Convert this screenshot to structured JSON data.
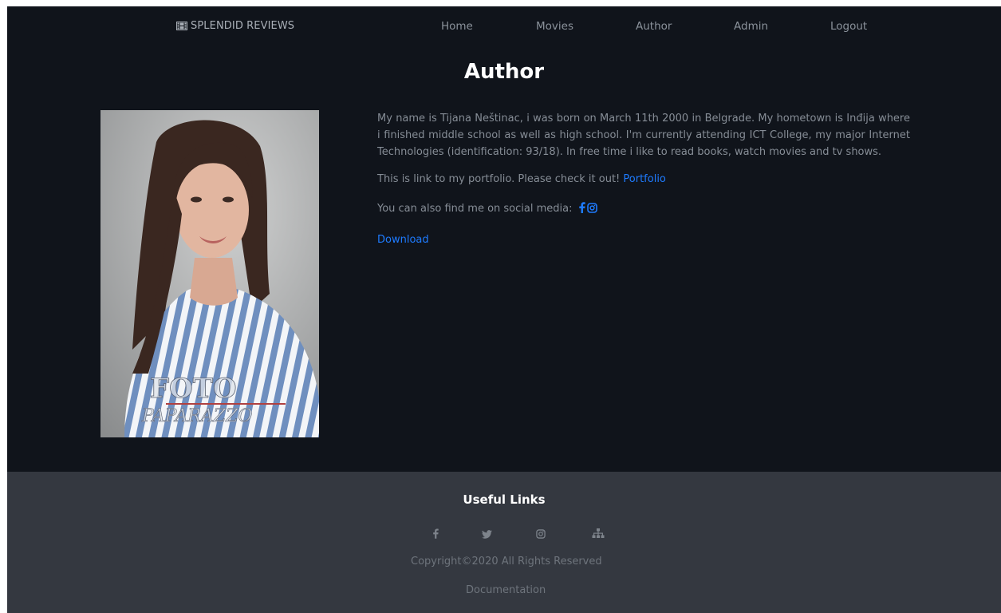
{
  "navbar": {
    "brand": "SPLENDID REVIEWS",
    "brand_icon": "film-icon",
    "links": [
      {
        "label": "Home"
      },
      {
        "label": "Movies"
      },
      {
        "label": "Author"
      },
      {
        "label": "Admin"
      },
      {
        "label": "Logout"
      }
    ]
  },
  "main": {
    "title": "Author",
    "photo_watermark": [
      "FOTO",
      "PAPARAZZO"
    ],
    "bio": "My name is Tijana Neštinac, i was born on March 11th 2000 in Belgrade. My hometown is Inđija where i finished middle school as well as high school. I'm currently attending ICT College, my major Internet Technologies (identification: 93/18). In free time i like to read books, watch movies and tv shows.",
    "portfolio_text": "This is link to my portfolio. Please check it out!",
    "portfolio_link": "Portfolio",
    "social_text": "You can also find me on social media:",
    "social_icons": [
      "facebook-icon",
      "instagram-icon"
    ],
    "download_link": "Download"
  },
  "footer": {
    "title": "Useful Links",
    "icons": [
      "facebook-icon",
      "twitter-icon",
      "instagram-icon",
      "sitemap-icon"
    ],
    "copyright": "Copyright©2020 All Rights Reserved",
    "documentation": "Documentation"
  },
  "colors": {
    "page_bg": "#10141b",
    "footer_bg": "#343840",
    "link": "#1e7bff",
    "body_text": "#868d96",
    "nav_text": "#8b929b"
  }
}
